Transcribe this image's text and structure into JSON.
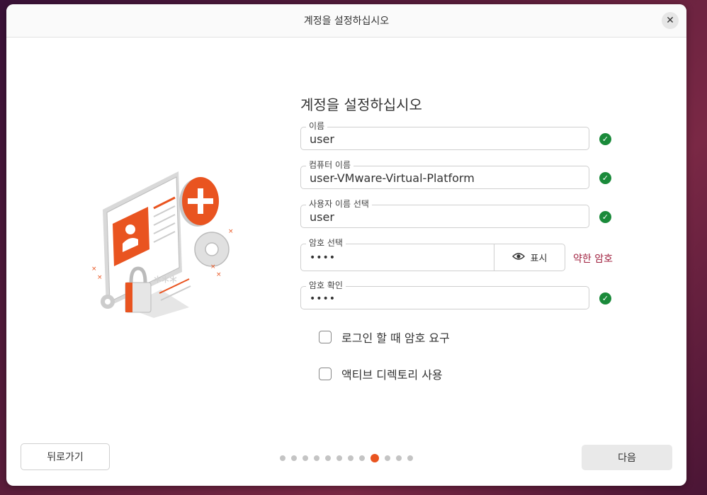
{
  "window": {
    "title": "계정을 설정하십시오"
  },
  "heading": "계정을 설정하십시오",
  "fields": {
    "name": {
      "label": "이름",
      "value": "user"
    },
    "computer": {
      "label": "컴퓨터 이름",
      "value": "user-VMware-Virtual-Platform"
    },
    "username": {
      "label": "사용자 이름 선택",
      "value": "user"
    },
    "password": {
      "label": "암호 선택",
      "value": "••••",
      "show_label": "표시",
      "strength": "약한 암호"
    },
    "confirm": {
      "label": "암호 확인",
      "value": "••••"
    }
  },
  "options": {
    "require_password": "로그인 할 때 암호 요구",
    "active_directory": "액티브 디렉토리 사용"
  },
  "nav": {
    "back_label": "뒤로가기",
    "next_label": "다음",
    "total_steps": 12,
    "current_step": 9
  },
  "colors": {
    "accent": "#e95420",
    "valid": "#1a8a3a",
    "weak": "#a0213f"
  }
}
